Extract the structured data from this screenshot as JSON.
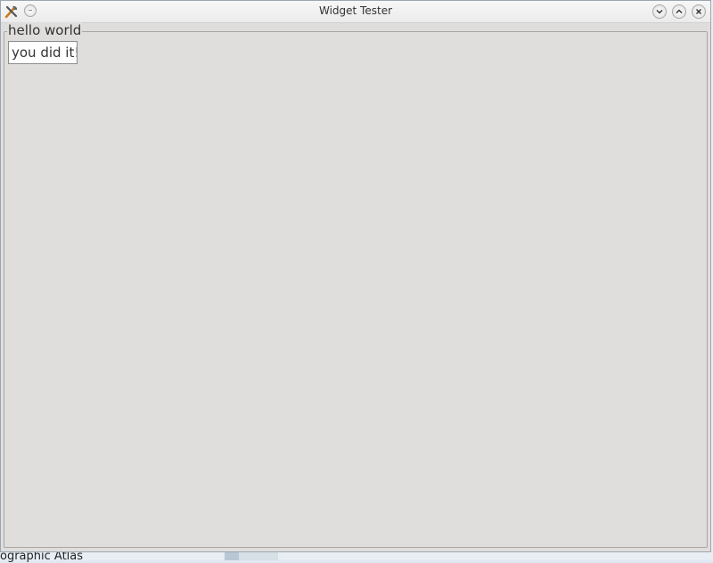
{
  "window": {
    "title": "Widget Tester"
  },
  "icons": {
    "app": "tools-icon",
    "menu": "window-menu-icon",
    "minimize": "chevron-down-icon",
    "maximize": "chevron-up-icon",
    "close": "close-icon"
  },
  "groupbox": {
    "title": "hello world"
  },
  "text_field": {
    "value": "you did it!"
  },
  "background": {
    "peek_text": "ographic Atlas"
  },
  "colors": {
    "window_bg": "#e0dedc",
    "titlebar_bg": "#f2f2f2",
    "field_bg": "#ffffff"
  }
}
